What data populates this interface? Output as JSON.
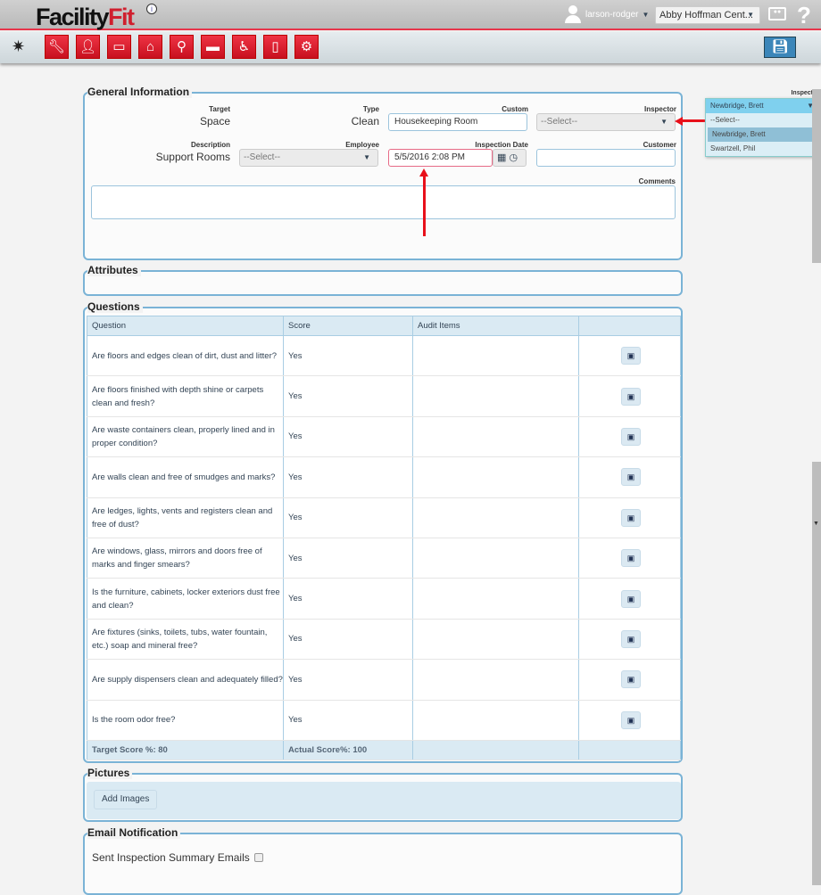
{
  "header": {
    "logo_left": "Facility",
    "logo_right": "Fit",
    "info": "i",
    "username": "larson-rodger",
    "site": "Abby Hoffman Cent...",
    "help": "?"
  },
  "toolbar": {
    "icons": [
      "wrench-icon",
      "user-icon",
      "monitor-icon",
      "home-icon",
      "search-icon",
      "bed-icon",
      "wheelchair-icon",
      "document-icon",
      "gears-icon"
    ],
    "accent": "#d01f2e"
  },
  "general": {
    "legend": "General Information",
    "target_label": "Target",
    "target": "Space",
    "type_label": "Type",
    "type": "Clean",
    "custom_label": "Custom",
    "custom": "Housekeeping Room",
    "inspector_label": "Inspector",
    "inspector": "--Select--",
    "description_label": "Description",
    "description": "Support Rooms",
    "employee_label": "Employee",
    "employee": "--Select--",
    "date_label": "Inspection Date",
    "date": "5/5/2016 2:08 PM",
    "customer_label": "Customer",
    "customer": "",
    "comments_label": "Comments",
    "comments": ""
  },
  "inspector_dropdown": {
    "label": "Inspector",
    "selected": "Newbridge, Brett",
    "options": [
      "--Select--",
      "Newbridge, Brett",
      "Swartzell, Phil"
    ]
  },
  "attributes": {
    "legend": "Attributes"
  },
  "questions": {
    "legend": "Questions",
    "columns": [
      "Question",
      "Score",
      "Audit Items",
      ""
    ],
    "rows": [
      {
        "q": "Are floors and edges clean of dirt, dust and litter?",
        "s": "Yes"
      },
      {
        "q": "Are floors finished with depth shine or carpets clean and fresh?",
        "s": "Yes"
      },
      {
        "q": "Are waste containers clean, properly lined and in proper condition?",
        "s": "Yes"
      },
      {
        "q": "Are walls clean and free of smudges and marks?",
        "s": "Yes"
      },
      {
        "q": "Are ledges, lights, vents and registers clean and free of dust?",
        "s": "Yes"
      },
      {
        "q": "Are windows, glass, mirrors and doors free of marks and finger smears?",
        "s": "Yes"
      },
      {
        "q": "Is the furniture, cabinets, locker exteriors dust free and clean?",
        "s": "Yes"
      },
      {
        "q": "Are fixtures (sinks, toilets, tubs, water fountain, etc.) soap and mineral free?",
        "s": "Yes"
      },
      {
        "q": "Are supply dispensers clean and adequately filled?",
        "s": "Yes"
      },
      {
        "q": "Is the room odor free?",
        "s": "Yes"
      }
    ],
    "target_score": "Target Score %: 80",
    "actual_score": "Actual Score%: 100"
  },
  "pictures": {
    "legend": "Pictures",
    "add_label": "Add Images"
  },
  "email": {
    "legend": "Email Notification",
    "label": "Sent Inspection Summary Emails",
    "checked": false
  }
}
